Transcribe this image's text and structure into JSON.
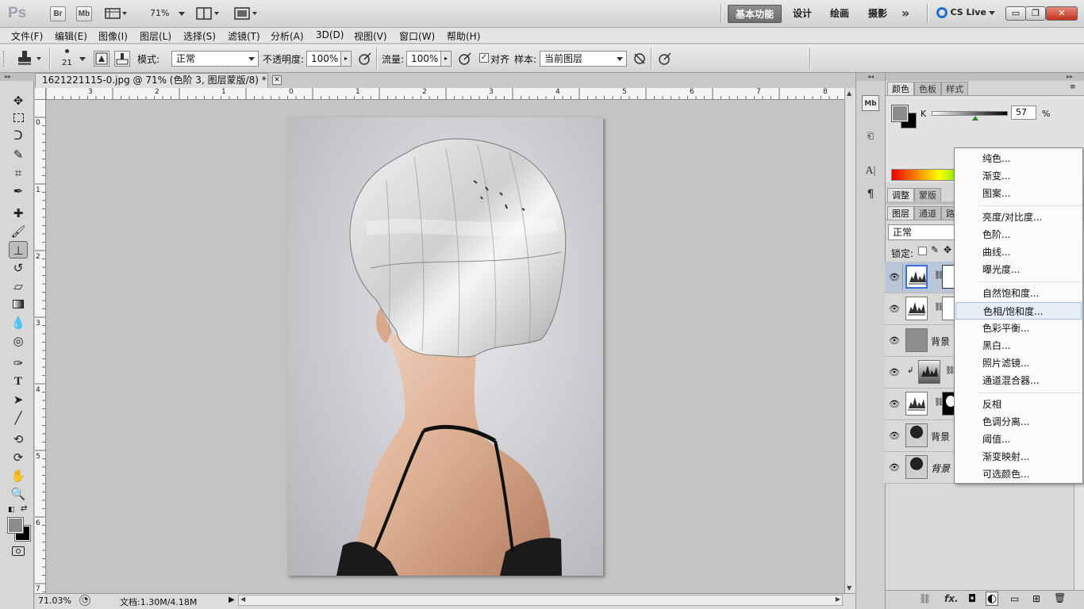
{
  "app": {
    "logo": "Ps",
    "bridge_button": "Br",
    "minibridge_button": "Mb",
    "zoom_display": "71%",
    "workspaces": [
      "基本功能",
      "设计",
      "绘画",
      "摄影"
    ],
    "more_workspaces": "»",
    "cslive": "CS Live",
    "window_controls": [
      "▭",
      "❐",
      "✕"
    ]
  },
  "menubar": [
    "文件(F)",
    "编辑(E)",
    "图像(I)",
    "图层(L)",
    "选择(S)",
    "滤镜(T)",
    "分析(A)",
    "3D(D)",
    "视图(V)",
    "窗口(W)",
    "帮助(H)"
  ],
  "options": {
    "brush_size": "21",
    "mode_label": "模式:",
    "mode_value": "正常",
    "opacity_label": "不透明度:",
    "opacity_value": "100%",
    "flow_label": "流量:",
    "flow_value": "100%",
    "aligned_label": "对齐",
    "aligned_checked": true,
    "sample_label": "样本:",
    "sample_value": "当前图层"
  },
  "document": {
    "tab_title": "1621221115-0.jpg @ 71% (色阶 3, 图层蒙版/8) *",
    "ruler_h": [
      "3",
      "2",
      "1",
      "0",
      "1",
      "2",
      "3",
      "4",
      "5",
      "6",
      "7",
      "8"
    ],
    "ruler_v": [
      "0",
      "1",
      "2",
      "3",
      "4",
      "5",
      "6",
      "7"
    ]
  },
  "status": {
    "zoom": "71.03%",
    "doc_info": "文档:1.30M/4.18M"
  },
  "color_panel": {
    "tabs": [
      "颜色",
      "色板",
      "样式"
    ],
    "channel": "K",
    "value": "57",
    "unit": "%",
    "foreground": "#8c8c8c",
    "background": "#000000"
  },
  "adjust_tabs": [
    "调整",
    "蒙版"
  ],
  "layers_panel": {
    "tabs": [
      "图层",
      "通道",
      "路"
    ],
    "blend_mode": "正常",
    "lock_label": "锁定:",
    "layers": [
      {
        "name": "",
        "type": "levels",
        "selected": true
      },
      {
        "name": "",
        "type": "levels",
        "selected": false
      },
      {
        "name": "背景 ",
        "type": "gray",
        "selected": false
      },
      {
        "name": "",
        "type": "levels-clip",
        "selected": false
      },
      {
        "name": "",
        "type": "levels-mask",
        "selected": false
      },
      {
        "name": "背景 ",
        "type": "photo",
        "selected": false
      },
      {
        "name": "背景",
        "type": "photo-italic",
        "selected": false
      }
    ],
    "footer_icons": [
      "link-icon",
      "fx-icon",
      "mask-icon",
      "adjustment-icon",
      "group-icon",
      "new-layer-icon",
      "trash-icon"
    ],
    "footer_glyphs": [
      "⛓",
      "fx.",
      "◘",
      "◐",
      "▭",
      "⊞",
      "🗑"
    ]
  },
  "adjustment_menu": {
    "groups": [
      [
        "纯色...",
        "渐变...",
        "图案..."
      ],
      [
        "亮度/对比度...",
        "色阶...",
        "曲线...",
        "曝光度..."
      ],
      [
        "自然饱和度...",
        "色相/饱和度...",
        "色彩平衡...",
        "黑白...",
        "照片滤镜...",
        "通道混合器..."
      ],
      [
        "反相",
        "色调分离...",
        "阈值...",
        "渐变映射...",
        "可选颜色..."
      ]
    ],
    "highlighted": "色相/饱和度..."
  }
}
